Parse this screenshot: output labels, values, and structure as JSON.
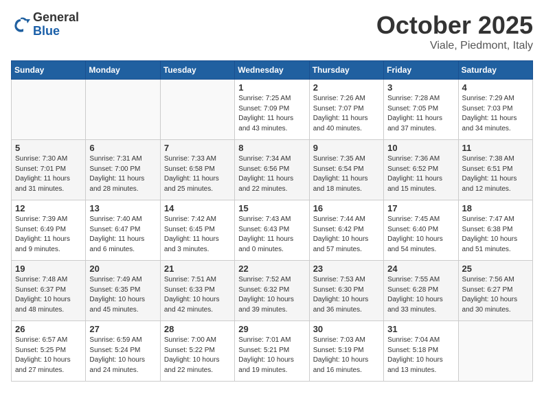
{
  "header": {
    "logo_general": "General",
    "logo_blue": "Blue",
    "month": "October 2025",
    "location": "Viale, Piedmont, Italy"
  },
  "days_of_week": [
    "Sunday",
    "Monday",
    "Tuesday",
    "Wednesday",
    "Thursday",
    "Friday",
    "Saturday"
  ],
  "weeks": [
    [
      {
        "day": "",
        "info": ""
      },
      {
        "day": "",
        "info": ""
      },
      {
        "day": "",
        "info": ""
      },
      {
        "day": "1",
        "info": "Sunrise: 7:25 AM\nSunset: 7:09 PM\nDaylight: 11 hours\nand 43 minutes."
      },
      {
        "day": "2",
        "info": "Sunrise: 7:26 AM\nSunset: 7:07 PM\nDaylight: 11 hours\nand 40 minutes."
      },
      {
        "day": "3",
        "info": "Sunrise: 7:28 AM\nSunset: 7:05 PM\nDaylight: 11 hours\nand 37 minutes."
      },
      {
        "day": "4",
        "info": "Sunrise: 7:29 AM\nSunset: 7:03 PM\nDaylight: 11 hours\nand 34 minutes."
      }
    ],
    [
      {
        "day": "5",
        "info": "Sunrise: 7:30 AM\nSunset: 7:01 PM\nDaylight: 11 hours\nand 31 minutes."
      },
      {
        "day": "6",
        "info": "Sunrise: 7:31 AM\nSunset: 7:00 PM\nDaylight: 11 hours\nand 28 minutes."
      },
      {
        "day": "7",
        "info": "Sunrise: 7:33 AM\nSunset: 6:58 PM\nDaylight: 11 hours\nand 25 minutes."
      },
      {
        "day": "8",
        "info": "Sunrise: 7:34 AM\nSunset: 6:56 PM\nDaylight: 11 hours\nand 22 minutes."
      },
      {
        "day": "9",
        "info": "Sunrise: 7:35 AM\nSunset: 6:54 PM\nDaylight: 11 hours\nand 18 minutes."
      },
      {
        "day": "10",
        "info": "Sunrise: 7:36 AM\nSunset: 6:52 PM\nDaylight: 11 hours\nand 15 minutes."
      },
      {
        "day": "11",
        "info": "Sunrise: 7:38 AM\nSunset: 6:51 PM\nDaylight: 11 hours\nand 12 minutes."
      }
    ],
    [
      {
        "day": "12",
        "info": "Sunrise: 7:39 AM\nSunset: 6:49 PM\nDaylight: 11 hours\nand 9 minutes."
      },
      {
        "day": "13",
        "info": "Sunrise: 7:40 AM\nSunset: 6:47 PM\nDaylight: 11 hours\nand 6 minutes."
      },
      {
        "day": "14",
        "info": "Sunrise: 7:42 AM\nSunset: 6:45 PM\nDaylight: 11 hours\nand 3 minutes."
      },
      {
        "day": "15",
        "info": "Sunrise: 7:43 AM\nSunset: 6:43 PM\nDaylight: 11 hours\nand 0 minutes."
      },
      {
        "day": "16",
        "info": "Sunrise: 7:44 AM\nSunset: 6:42 PM\nDaylight: 10 hours\nand 57 minutes."
      },
      {
        "day": "17",
        "info": "Sunrise: 7:45 AM\nSunset: 6:40 PM\nDaylight: 10 hours\nand 54 minutes."
      },
      {
        "day": "18",
        "info": "Sunrise: 7:47 AM\nSunset: 6:38 PM\nDaylight: 10 hours\nand 51 minutes."
      }
    ],
    [
      {
        "day": "19",
        "info": "Sunrise: 7:48 AM\nSunset: 6:37 PM\nDaylight: 10 hours\nand 48 minutes."
      },
      {
        "day": "20",
        "info": "Sunrise: 7:49 AM\nSunset: 6:35 PM\nDaylight: 10 hours\nand 45 minutes."
      },
      {
        "day": "21",
        "info": "Sunrise: 7:51 AM\nSunset: 6:33 PM\nDaylight: 10 hours\nand 42 minutes."
      },
      {
        "day": "22",
        "info": "Sunrise: 7:52 AM\nSunset: 6:32 PM\nDaylight: 10 hours\nand 39 minutes."
      },
      {
        "day": "23",
        "info": "Sunrise: 7:53 AM\nSunset: 6:30 PM\nDaylight: 10 hours\nand 36 minutes."
      },
      {
        "day": "24",
        "info": "Sunrise: 7:55 AM\nSunset: 6:28 PM\nDaylight: 10 hours\nand 33 minutes."
      },
      {
        "day": "25",
        "info": "Sunrise: 7:56 AM\nSunset: 6:27 PM\nDaylight: 10 hours\nand 30 minutes."
      }
    ],
    [
      {
        "day": "26",
        "info": "Sunrise: 6:57 AM\nSunset: 5:25 PM\nDaylight: 10 hours\nand 27 minutes."
      },
      {
        "day": "27",
        "info": "Sunrise: 6:59 AM\nSunset: 5:24 PM\nDaylight: 10 hours\nand 24 minutes."
      },
      {
        "day": "28",
        "info": "Sunrise: 7:00 AM\nSunset: 5:22 PM\nDaylight: 10 hours\nand 22 minutes."
      },
      {
        "day": "29",
        "info": "Sunrise: 7:01 AM\nSunset: 5:21 PM\nDaylight: 10 hours\nand 19 minutes."
      },
      {
        "day": "30",
        "info": "Sunrise: 7:03 AM\nSunset: 5:19 PM\nDaylight: 10 hours\nand 16 minutes."
      },
      {
        "day": "31",
        "info": "Sunrise: 7:04 AM\nSunset: 5:18 PM\nDaylight: 10 hours\nand 13 minutes."
      },
      {
        "day": "",
        "info": ""
      }
    ]
  ]
}
